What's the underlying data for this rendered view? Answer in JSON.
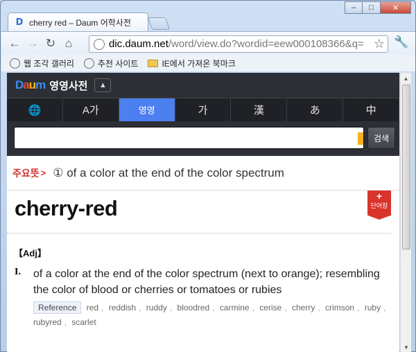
{
  "browser": {
    "tab_title": "cherry red – Daum 어학사전",
    "tab_favicon": "D",
    "url_host": "dic.daum.net",
    "url_path": "/word/view.do?wordid=eew000108366&q=",
    "bookmarks": [
      {
        "label": "웹 조각 갤러리",
        "icon": "globe-icon"
      },
      {
        "label": "추천 사이트",
        "icon": "globe-icon"
      },
      {
        "label": "IE에서 가져온 북마크",
        "icon": "folder-icon"
      }
    ],
    "controls": {
      "minimize": "–",
      "maximize": "□",
      "close": "✕"
    }
  },
  "daum": {
    "logo_letters": [
      "D",
      "a",
      "u",
      "m"
    ],
    "dict_name": "영영사전",
    "lang_tabs": [
      {
        "label": "🌐",
        "icon": "globe-icon"
      },
      {
        "label": "A가"
      },
      {
        "label": "영영",
        "active": true
      },
      {
        "label": "가"
      },
      {
        "label": "漢"
      },
      {
        "label": "あ"
      },
      {
        "label": "中"
      }
    ],
    "search_button": "검색",
    "search_value": ""
  },
  "entry": {
    "summary_key": "주요뜻",
    "summary_text": "① of a color at the end of the color spectrum",
    "headword": "cherry-red",
    "wordbook_label": "단어장",
    "wordbook_plus": "+",
    "pos": "【Adj】",
    "senses": [
      {
        "num": "I.",
        "definition": "of a color at the end of the color spectrum (next to orange); resembling the color of blood or cherries or tomatoes or rubies",
        "reference_label": "Reference",
        "references": [
          "red",
          "reddish",
          "ruddy",
          "bloodred",
          "carmine",
          "cerise",
          "cherry",
          "crimson",
          "ruby",
          "rubyred",
          "scarlet"
        ]
      }
    ]
  },
  "colors": {
    "accent_tab": "#4c7ff0",
    "summary_key": "#d2322d",
    "badge": "#d9342b"
  }
}
